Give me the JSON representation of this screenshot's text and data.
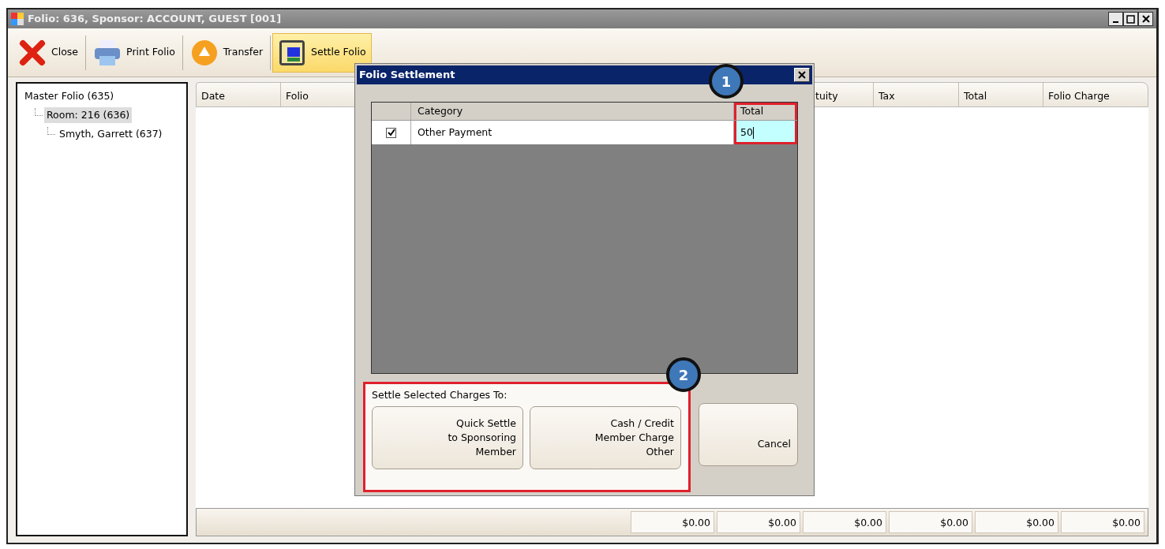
{
  "window": {
    "title": "Folio: 636, Sponsor: ACCOUNT, GUEST [001]"
  },
  "toolbar": [
    {
      "kind": "close",
      "label": "Close",
      "selected": false
    },
    {
      "kind": "print",
      "label": "Print Folio",
      "selected": false
    },
    {
      "kind": "transfer",
      "label": "Transfer",
      "selected": false
    },
    {
      "kind": "settle",
      "label": "Settle Folio",
      "selected": true
    }
  ],
  "tree": [
    {
      "label": "Master Folio (635)",
      "selected": false,
      "children": [
        {
          "label": "Room: 216 (636)",
          "selected": true,
          "children": [
            {
              "label": "Smyth, Garrett (637)",
              "selected": false
            }
          ]
        }
      ]
    }
  ],
  "grid": {
    "columns": [
      "Date",
      "Folio",
      "tuity",
      "Tax",
      "Total",
      "Folio Charge"
    ],
    "totals": [
      "$0.00",
      "$0.00",
      "$0.00",
      "$0.00",
      "$0.00",
      "$0.00"
    ]
  },
  "dialog": {
    "title": "Folio Settlement",
    "columns": [
      "Category",
      "Total"
    ],
    "rows": [
      {
        "checked": true,
        "category": "Other Payment",
        "total": "50"
      }
    ],
    "group_label": "Settle Selected Charges To:",
    "buttons": [
      {
        "lines": [
          "Quick Settle",
          "to Sponsoring",
          "Member"
        ]
      },
      {
        "lines": [
          "Cash / Credit",
          "Member Charge",
          "Other"
        ]
      }
    ],
    "cancel": "Cancel"
  },
  "callouts": [
    "1",
    "2"
  ]
}
